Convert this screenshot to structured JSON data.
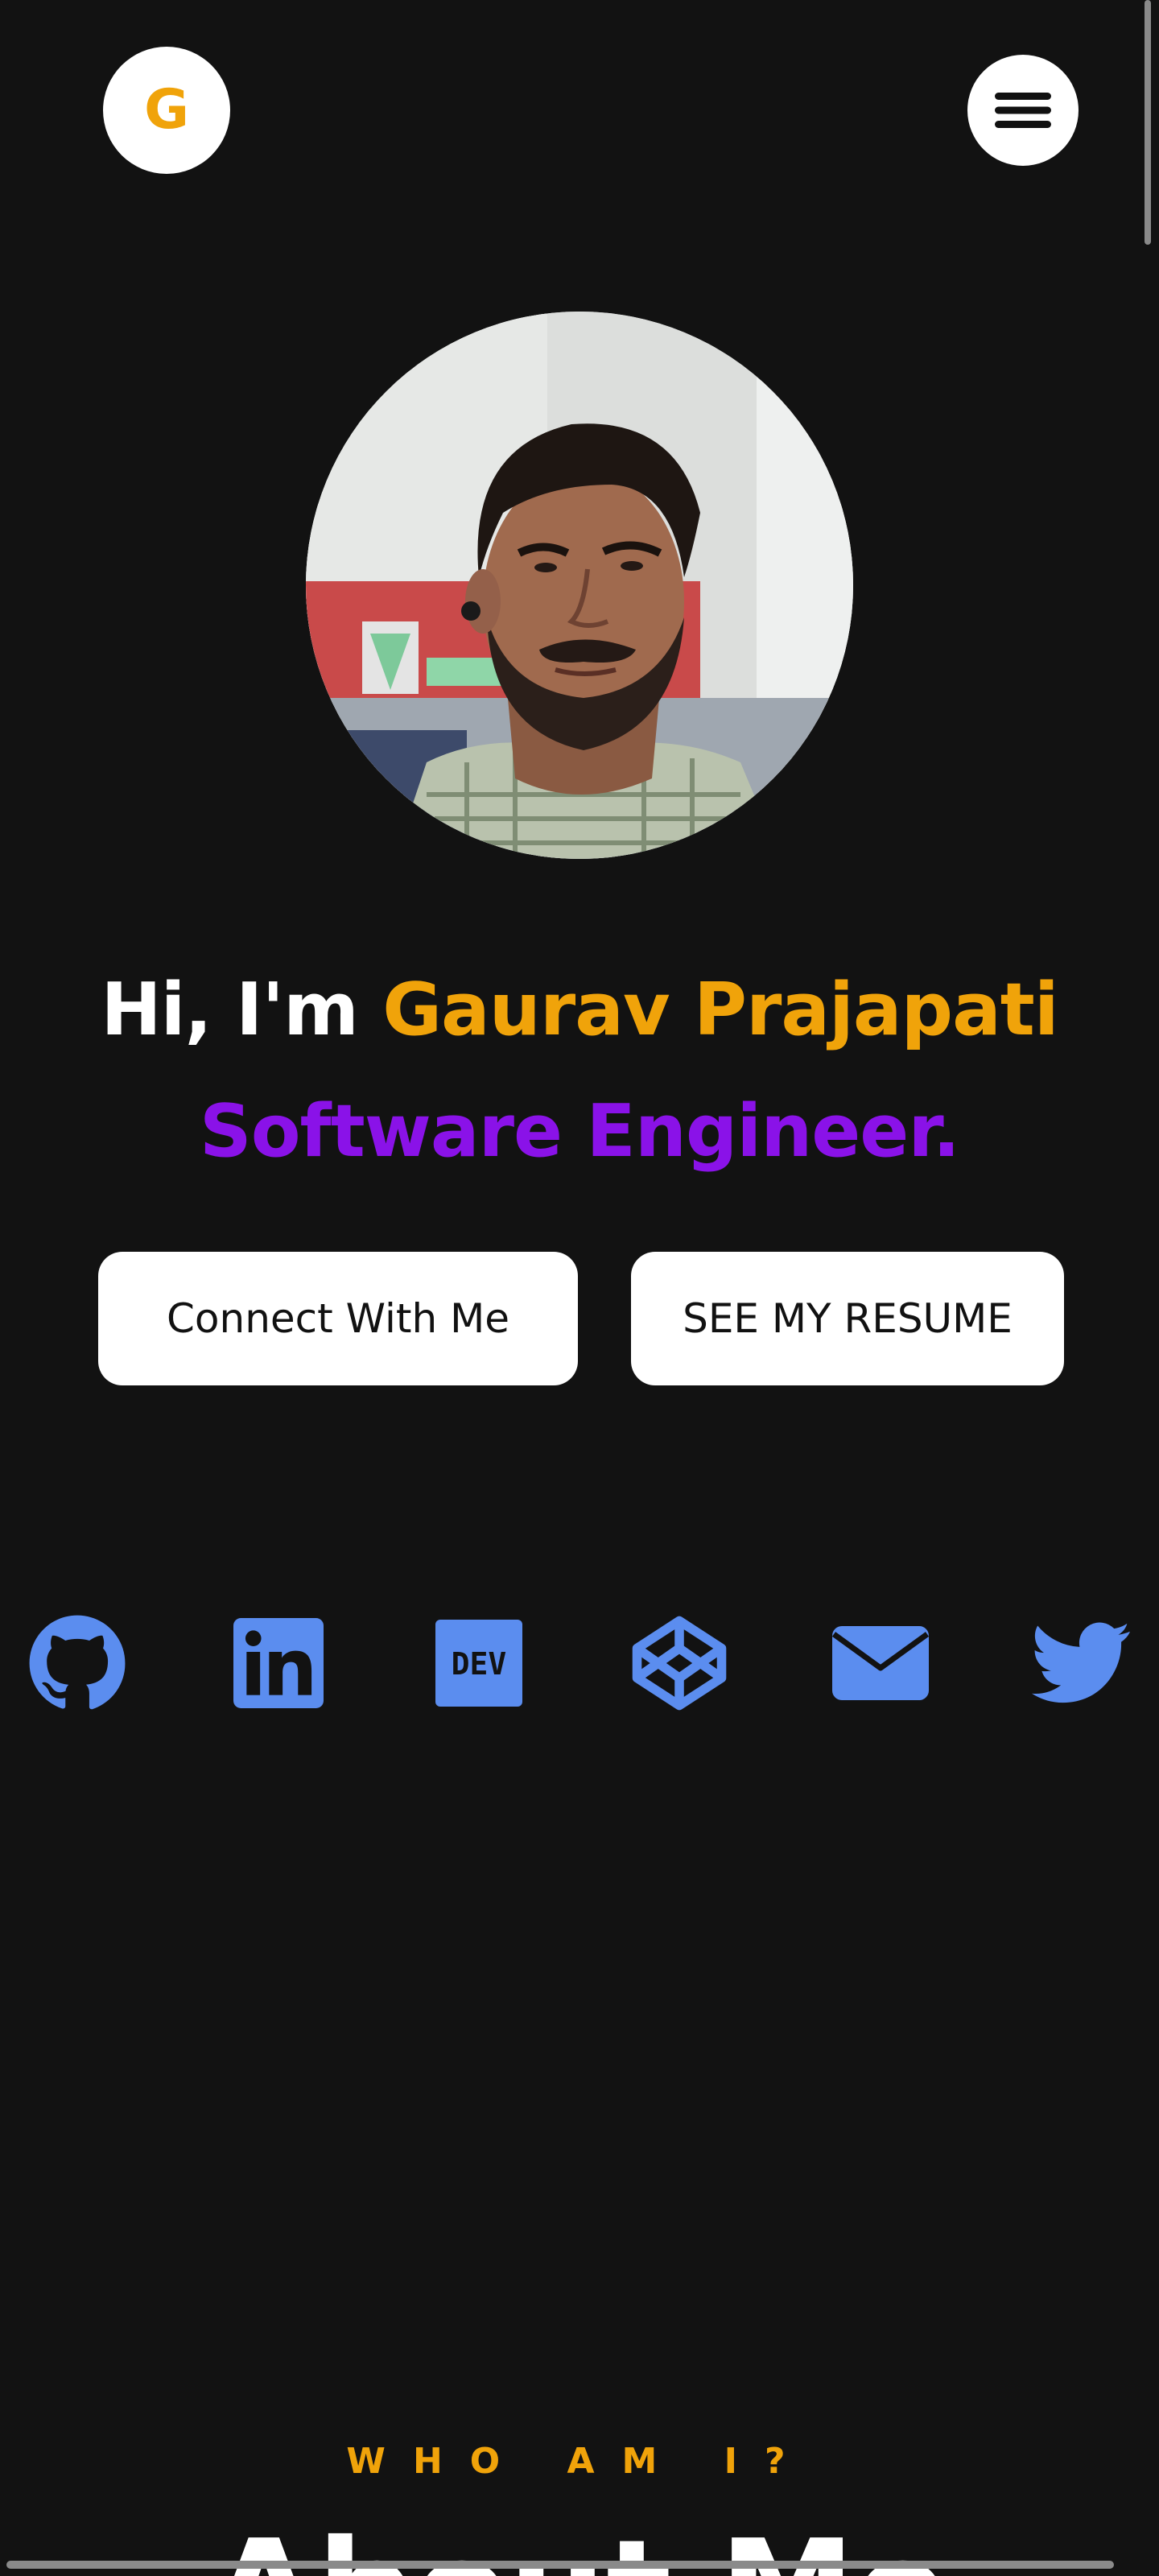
{
  "header": {
    "logo_letter": "G",
    "logo_color": "#f0a30a",
    "menu_icon": "hamburger-menu-icon"
  },
  "hero": {
    "greeting": "Hi, I'm ",
    "name": "Gaurav Prajapati",
    "role": "Software Engineer.",
    "avatar": "profile-photo",
    "colors": {
      "background": "#121212",
      "name": "#f0a30a",
      "role": "#8a12e8",
      "icons": "#5b8def"
    }
  },
  "buttons": {
    "connect_label": "Connect With Me",
    "resume_label": "SEE MY RESUME"
  },
  "social_links": [
    {
      "icon": "github-icon"
    },
    {
      "icon": "linkedin-icon"
    },
    {
      "icon": "dev-to-icon",
      "text": "DEV"
    },
    {
      "icon": "codepen-icon"
    },
    {
      "icon": "email-icon"
    },
    {
      "icon": "twitter-icon"
    }
  ],
  "about": {
    "eyebrow": "WHO AM I?",
    "title": "About Me"
  }
}
